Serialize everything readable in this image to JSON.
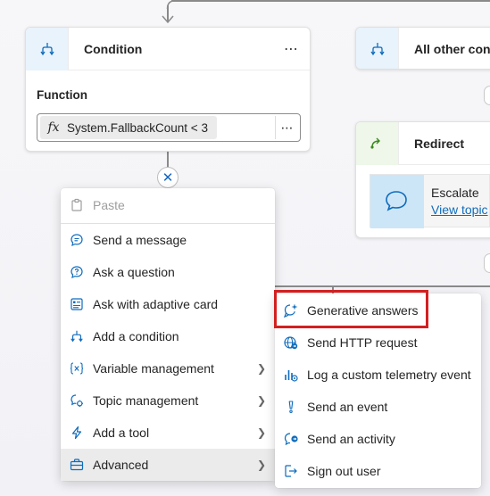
{
  "condition_node": {
    "title": "Condition",
    "more_label": "⋯",
    "function_label": "Function",
    "fx_symbol": "fx",
    "expression": "System.FallbackCount < 3",
    "expression_more": "⋯"
  },
  "other_condition_node": {
    "title": "All other conditions"
  },
  "redirect_node": {
    "title": "Redirect",
    "card_title": "Escalate",
    "card_link": "View topic"
  },
  "close_symbol": "✕",
  "primary_menu": {
    "items": [
      {
        "label": "Paste",
        "icon": "clipboard-icon",
        "disabled": true
      },
      {
        "label": "Send a message",
        "icon": "chat-message-icon"
      },
      {
        "label": "Ask a question",
        "icon": "question-bubble-icon"
      },
      {
        "label": "Ask with adaptive card",
        "icon": "adaptive-card-icon"
      },
      {
        "label": "Add a condition",
        "icon": "branch-icon"
      },
      {
        "label": "Variable management",
        "icon": "variable-icon",
        "submenu": true
      },
      {
        "label": "Topic management",
        "icon": "topic-icon",
        "submenu": true
      },
      {
        "label": "Add a tool",
        "icon": "lightning-icon",
        "submenu": true
      },
      {
        "label": "Advanced",
        "icon": "toolbox-icon",
        "submenu": true,
        "active": true
      }
    ],
    "chevron": "❯"
  },
  "advanced_menu": {
    "items": [
      {
        "label": "Generative answers",
        "icon": "generative-sparkle-icon"
      },
      {
        "label": "Send HTTP request",
        "icon": "globe-request-icon"
      },
      {
        "label": "Log a custom telemetry event",
        "icon": "telemetry-chart-icon"
      },
      {
        "label": "Send an event",
        "icon": "exclamation-icon"
      },
      {
        "label": "Send an activity",
        "icon": "activity-bubble-icon"
      },
      {
        "label": "Sign out user",
        "icon": "sign-out-icon"
      }
    ]
  },
  "colors": {
    "accent": "#0f6cbd",
    "highlight": "#d32020",
    "condition_icon_bg": "#e8f3fc",
    "redirect_icon_bg": "#eef7e9"
  }
}
